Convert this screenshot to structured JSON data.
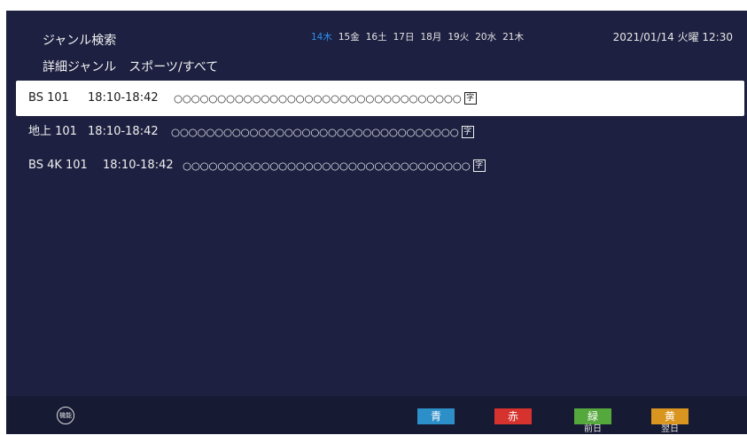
{
  "header": {
    "title": "ジャンル検索",
    "dates": [
      "14木",
      "15金",
      "16土",
      "17日",
      "18月",
      "19火",
      "20水",
      "21木"
    ],
    "selected_date_index": 0,
    "clock": "2021/01/14 火曜 12:30"
  },
  "subheader": "詳細ジャンル　スポーツ/すべて",
  "rows": [
    {
      "channel": "BS 101",
      "time": "18:10-18:42",
      "program": "○○○○○○○○○○○○○○○○○○○○○○○○○○○○○○○○○",
      "badge": "字",
      "selected": true
    },
    {
      "channel": "地上 101",
      "time": "18:10-18:42",
      "program": "○○○○○○○○○○○○○○○○○○○○○○○○○○○○○○○○○",
      "badge": "字",
      "selected": false
    },
    {
      "channel": "BS 4K 101",
      "time": "18:10-18:42",
      "program": "○○○○○○○○○○○○○○○○○○○○○○○○○○○○○○○○○",
      "badge": "字",
      "selected": false
    }
  ],
  "footer": {
    "function_icon_label": "機能",
    "keys": [
      {
        "name": "青",
        "sub": "",
        "color": "#2c8fc8"
      },
      {
        "name": "赤",
        "sub": "",
        "color": "#d6332e"
      },
      {
        "name": "緑",
        "sub": "前日",
        "color": "#55a83c"
      },
      {
        "name": "黄",
        "sub": "翌日",
        "color": "#d9951f"
      }
    ]
  },
  "colors": {
    "background": "#1d2040",
    "footer": "#161a33",
    "accent": "#2b8ff0",
    "selected_row": "#ffffff"
  }
}
